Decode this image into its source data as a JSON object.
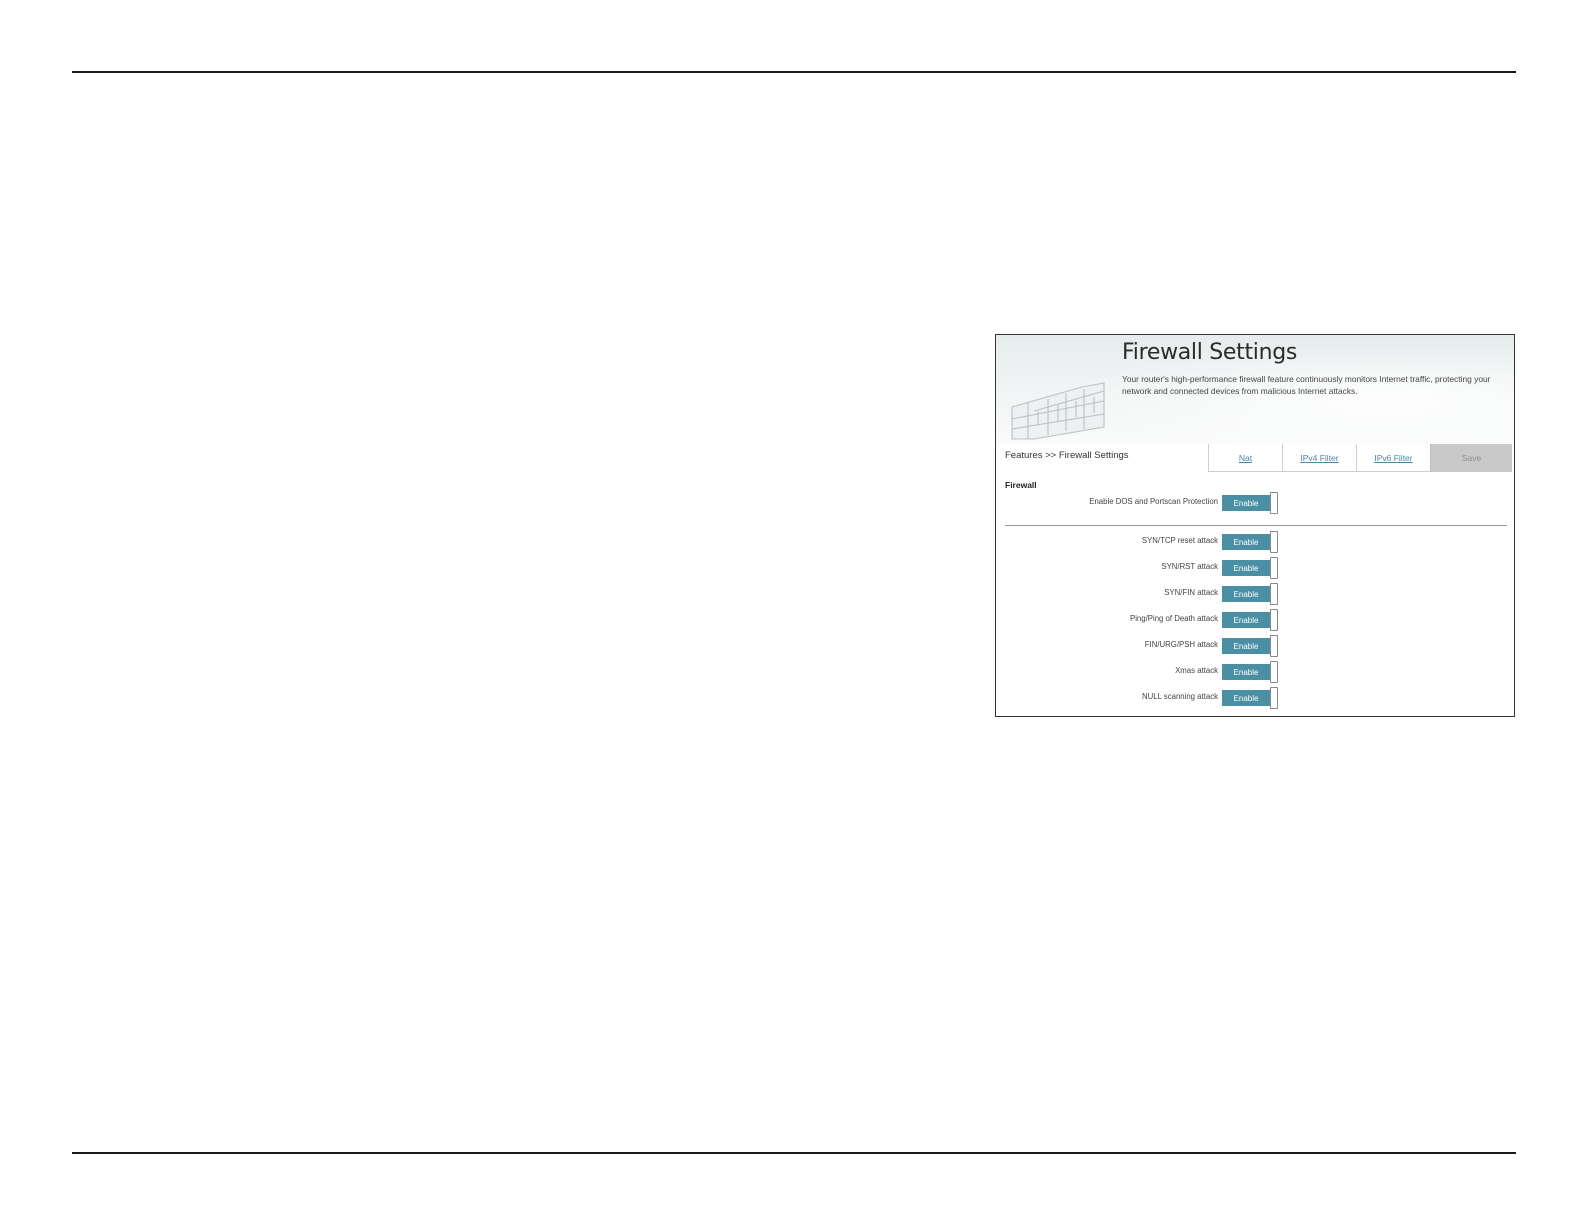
{
  "panel": {
    "title": "Firewall Settings",
    "description": "Your router's high-performance firewall feature continuously monitors Internet traffic, protecting your network and connected devices from malicious Internet attacks.",
    "breadcrumb": "Features >> Firewall Settings",
    "tabs": {
      "nat": "Nat",
      "ipv4": "IPv4 Filter",
      "ipv6": "IPv6 Filter",
      "save": "Save"
    },
    "section_title": "Firewall",
    "toggle_color": "#4a8fa3",
    "ddos": {
      "label": "Enable DOS and Portscan Protection",
      "state": "Enable"
    },
    "attacks": [
      {
        "label": "SYN/TCP reset attack",
        "state": "Enable"
      },
      {
        "label": "SYN/RST attack",
        "state": "Enable"
      },
      {
        "label": "SYN/FIN attack",
        "state": "Enable"
      },
      {
        "label": "Ping/Ping of Death attack",
        "state": "Enable"
      },
      {
        "label": "FIN/URG/PSH attack",
        "state": "Enable"
      },
      {
        "label": "Xmas attack",
        "state": "Enable"
      },
      {
        "label": "NULL scanning attack",
        "state": "Enable"
      }
    ]
  }
}
